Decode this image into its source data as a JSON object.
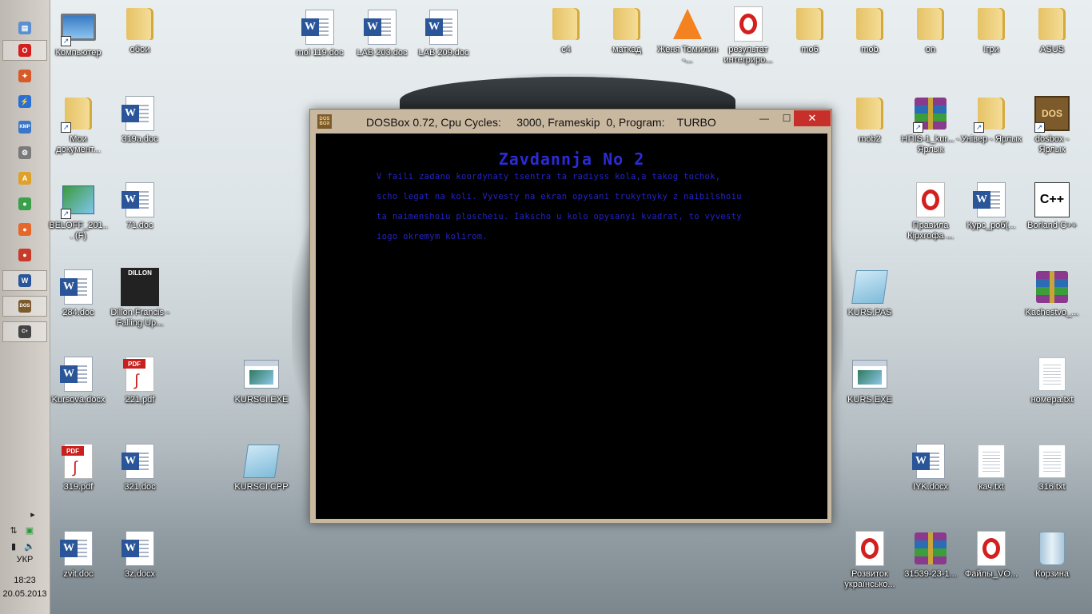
{
  "taskbar": {
    "buttons": [
      {
        "name": "explorer-taskbar-icon",
        "glyph": "▤",
        "color": "#5a8fd0"
      },
      {
        "name": "opera-taskbar-icon",
        "glyph": "O",
        "color": "#d41f1f"
      },
      {
        "name": "game-taskbar-icon",
        "glyph": "✦",
        "color": "#d85a28"
      },
      {
        "name": "lightning-taskbar-icon",
        "glyph": "⚡",
        "color": "#2a6fd4"
      },
      {
        "name": "kmp-taskbar-icon",
        "glyph": "KMP",
        "color": "#3a77c8"
      },
      {
        "name": "settings-taskbar-icon",
        "glyph": "⚙",
        "color": "#7a7a7a"
      },
      {
        "name": "aimp-taskbar-icon",
        "glyph": "A",
        "color": "#e0a12a"
      },
      {
        "name": "chrome-taskbar-icon",
        "glyph": "●",
        "color": "#3aa14a"
      },
      {
        "name": "firefox-taskbar-icon",
        "glyph": "●",
        "color": "#e5682a"
      },
      {
        "name": "opera-alt-taskbar-icon",
        "glyph": "●",
        "color": "#c83b2b"
      },
      {
        "name": "word-taskbar-icon",
        "glyph": "W",
        "color": "#2a5699"
      },
      {
        "name": "dosbox-taskbar-icon",
        "glyph": "DOS",
        "color": "#7d5a2c"
      },
      {
        "name": "borland-taskbar-icon",
        "glyph": "C+",
        "color": "#444444"
      }
    ],
    "language": "УКР",
    "time": "18:23",
    "date": "20.05.2013"
  },
  "desktop": {
    "icons": [
      {
        "label": "Компьютер",
        "type": "computer",
        "shortcut": true
      },
      {
        "label": "обои",
        "type": "folder"
      },
      {
        "label": "mol 119.doc",
        "type": "word"
      },
      {
        "label": "LAB 203.doc",
        "type": "word"
      },
      {
        "label": "LAB 209.doc",
        "type": "word"
      },
      {
        "label": "c4",
        "type": "folder"
      },
      {
        "label": "маткад",
        "type": "folder"
      },
      {
        "label": "Женя Томилин -...",
        "type": "vlc"
      },
      {
        "label": "результат интегриро...",
        "type": "opera"
      },
      {
        "label": "mo6",
        "type": "folder"
      },
      {
        "label": "mob",
        "type": "folder"
      },
      {
        "label": "on",
        "type": "folder"
      },
      {
        "label": "Ігри",
        "type": "folder"
      },
      {
        "label": "ASUS",
        "type": "folder"
      },
      {
        "label": "Мои документ...",
        "type": "folder",
        "shortcut": true
      },
      {
        "label": "319a.doc",
        "type": "word"
      },
      {
        "label": "mob2",
        "type": "folder"
      },
      {
        "label": "НПІS-1_kur... - Ярлык",
        "type": "rar",
        "shortcut": true
      },
      {
        "label": "Універ - Ярлык",
        "type": "folder",
        "shortcut": true
      },
      {
        "label": "dosbox - Ярлык",
        "type": "dosbox",
        "shortcut": true
      },
      {
        "label": "BELOFF_201... (F)",
        "type": "setup",
        "shortcut": true
      },
      {
        "label": "71.doc",
        "type": "word"
      },
      {
        "label": "Правила Кірхгофа ...",
        "type": "opera"
      },
      {
        "label": "Курс_роб(...",
        "type": "word"
      },
      {
        "label": "Borland C++",
        "type": "borland"
      },
      {
        "label": "284.doc",
        "type": "word"
      },
      {
        "label": "Dillon Francis - Falling Up...",
        "type": "album"
      },
      {
        "label": "KURS.PAS",
        "type": "notepad"
      },
      {
        "label": "Kachestvo_...",
        "type": "rar"
      },
      {
        "label": "Kursova.docx",
        "type": "word"
      },
      {
        "label": "221.pdf",
        "type": "pdf"
      },
      {
        "label": "KURSCI.EXE",
        "type": "exe"
      },
      {
        "label": "KURS.EXE",
        "type": "exe"
      },
      {
        "label": "номера.txt",
        "type": "txt"
      },
      {
        "label": "319.pdf",
        "type": "pdf"
      },
      {
        "label": "321.doc",
        "type": "word"
      },
      {
        "label": "KURSCI.CPP",
        "type": "notepad"
      },
      {
        "label": "IYK.docx",
        "type": "word"
      },
      {
        "label": "кач.txt",
        "type": "txt"
      },
      {
        "label": "316.txt",
        "type": "txt"
      },
      {
        "label": "zvit.doc",
        "type": "word"
      },
      {
        "label": "3z.docx",
        "type": "word"
      },
      {
        "label": "Розвиток українсько...",
        "type": "opera"
      },
      {
        "label": "31539-23-1...",
        "type": "rar"
      },
      {
        "label": "Файлы_VO...",
        "type": "opera"
      },
      {
        "label": "Корзина",
        "type": "trash"
      }
    ]
  },
  "dosbox": {
    "icon_text": "DOS BOX",
    "title": "DOSBox 0.72, Cpu Cycles:     3000, Frameskip  0, Program:    TURBO",
    "minimize": "—",
    "maximize": "☐",
    "close": "✕",
    "screen_title": "Zavdannja No 2",
    "screen_lines": [
      "V faili zadano koordynaty tsentra ta radiyss kola,a takog tochok,",
      "scho legat na koli. Vyvesty na ekran opysani trukytnyky z naibilshoiu",
      "ta naimenshoiu ploscheiu. Iakscho u kolo opysanyi kvadrat, to vyvesty",
      "iogo okremym kolirom."
    ]
  }
}
